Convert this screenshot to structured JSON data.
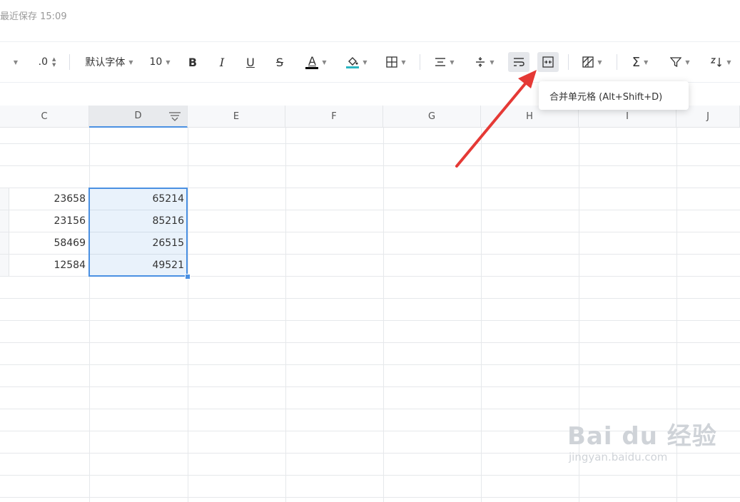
{
  "save_status": "最近保存 15:09",
  "toolbar": {
    "decimal_label": ".0",
    "font_label": "默认字体",
    "font_size": "10",
    "bold_label": "B",
    "italic_label": "I",
    "underline_label": "U",
    "strike_label": "S",
    "font_color_label": "A",
    "font_color_bar": "#000000",
    "fill_color_bar": "#2bb6c2",
    "sum_label": "Σ"
  },
  "tooltip": "合并单元格 (Alt+Shift+D)",
  "columns": [
    "C",
    "D",
    "E",
    "F",
    "G",
    "H",
    "I",
    "J"
  ],
  "cells": {
    "c": [
      "23658",
      "23156",
      "58469",
      "12584"
    ],
    "d": [
      "65214",
      "85216",
      "26515",
      "49521"
    ]
  },
  "annotation_color": "#e53935",
  "watermark": {
    "brand": "Bai du 经验",
    "url": "jingyan.baidu.com"
  }
}
